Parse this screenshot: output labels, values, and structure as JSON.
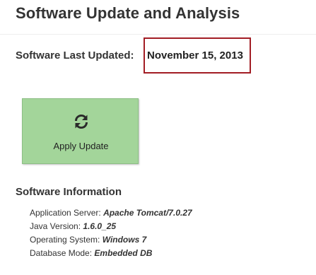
{
  "header": {
    "title": "Software Update and Analysis"
  },
  "last_updated": {
    "label": "Software Last Updated:",
    "value": "November 15, 2013"
  },
  "apply_button": {
    "label": "Apply Update",
    "icon": "refresh-icon",
    "bg_color": "#a3d59a"
  },
  "highlight_color": "#a21d24",
  "software_info": {
    "heading": "Software Information",
    "items": [
      {
        "label": "Application Server:",
        "value": "Apache Tomcat/7.0.27"
      },
      {
        "label": "Java Version:",
        "value": "1.6.0_25"
      },
      {
        "label": "Operating System:",
        "value": "Windows 7"
      },
      {
        "label": "Database Mode:",
        "value": "Embedded DB"
      }
    ]
  }
}
